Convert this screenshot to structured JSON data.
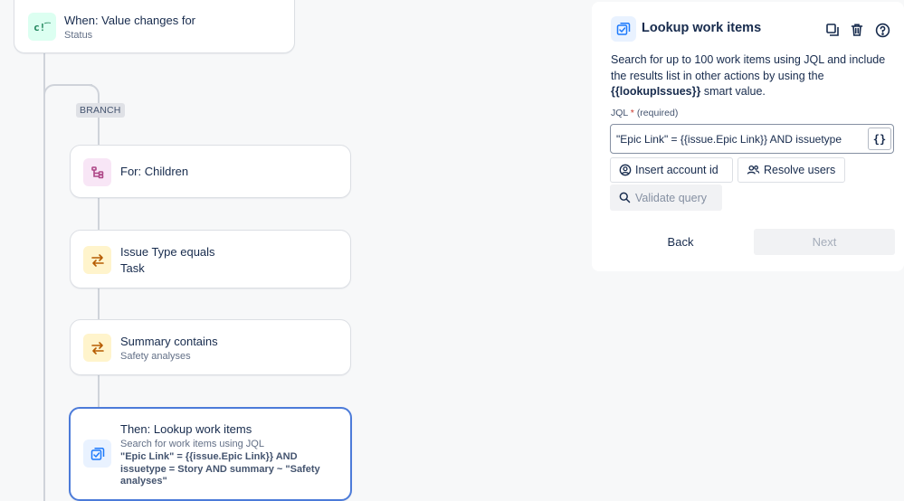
{
  "flow": {
    "trigger": {
      "title": "When: Value changes for",
      "subtitle": "Status",
      "icon": "trigger-icon",
      "color": "#1f845a"
    },
    "branch_label": "BRANCH",
    "branch_node": {
      "title": "For: Children",
      "icon": "hierarchy-icon",
      "color": "#ae4787"
    },
    "condition_type": {
      "title": "Issue Type equals",
      "value": "Task",
      "icon": "swap-arrows-icon",
      "color": "#b65c02"
    },
    "condition_summary": {
      "title": "Summary contains",
      "subtitle": "Safety analyses",
      "icon": "swap-arrows-icon",
      "color": "#b65c02"
    },
    "action": {
      "title": "Then: Lookup work items",
      "subtitle": "Search for work items using JQL",
      "jql": "\"Epic Link\" = {{issue.Epic Link}} AND issuetype = Story AND summary ~ \"Safety analyses\"",
      "icon": "lookup-icon",
      "color": "#1d7afc"
    }
  },
  "panel": {
    "title": "Lookup work items",
    "icons": [
      "copy-icon",
      "trash-icon",
      "help-icon"
    ],
    "description_pre": "Search for up to 100 work items using JQL and include the results list in other actions by using the ",
    "description_bold": "{{lookupIssues}}",
    "description_post": " smart value.",
    "jql_label": "JQL",
    "jql_required_mark": "*",
    "jql_required_text": "(required)",
    "jql_value": "\"Epic Link\" = {{issue.Epic Link}} AND issuetype",
    "smart_value_button": "{}",
    "insert_account_label": "Insert account id",
    "resolve_users_label": "Resolve users",
    "validate_label": "Validate query",
    "back_label": "Back",
    "next_label": "Next",
    "accent": "#1d7afc"
  }
}
